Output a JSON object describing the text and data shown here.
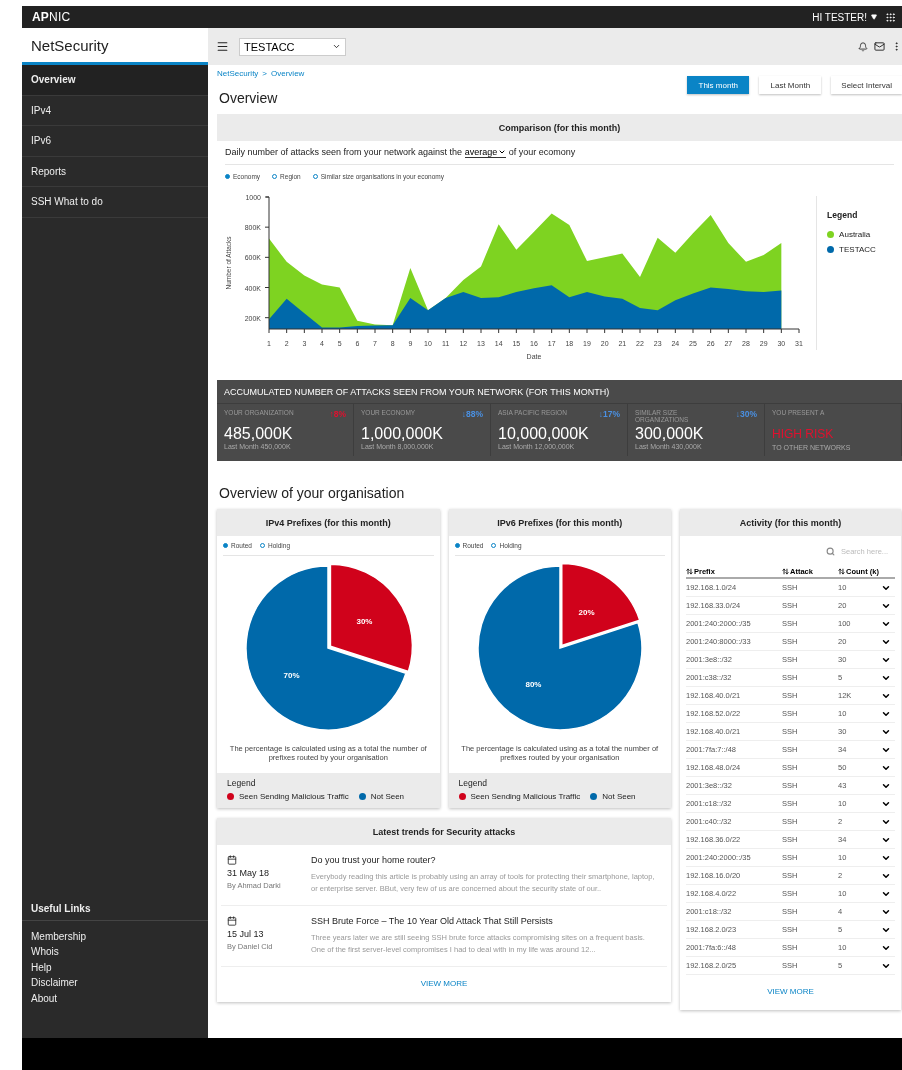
{
  "topbar": {
    "logo": "**AP**NIC",
    "user": "HI TESTER!"
  },
  "sidebar": {
    "title": "NetSecurity",
    "items": [
      {
        "label": "Overview",
        "selected": true
      },
      {
        "label": "IPv4",
        "selected": false
      },
      {
        "label": "IPv6",
        "selected": false
      },
      {
        "label": "Reports",
        "selected": false
      },
      {
        "label": "SSH What to do",
        "selected": false
      }
    ],
    "links_title": "Useful Links",
    "links": [
      "Membership",
      "Whois",
      "Help",
      "Disclaimer",
      "About"
    ]
  },
  "toolbar": {
    "account": "TESTACC"
  },
  "breadcrumb": {
    "items": [
      "NetSecurity",
      "Overview"
    ],
    "separator": ">"
  },
  "period_buttons": [
    {
      "label": "This month",
      "selected": true
    },
    {
      "label": "Last Month",
      "selected": false
    },
    {
      "label": "Select Interval",
      "selected": false
    }
  ],
  "page_title": "Overview",
  "comparison": {
    "title": "Comparison (for this month)",
    "sentence_before": "Daily number of attacks seen from your network against the",
    "dropdown": "average",
    "sentence_after": "of your ecomony",
    "filters": [
      {
        "label": "Economy",
        "selected": true
      },
      {
        "label": "Region",
        "selected": false
      },
      {
        "label": "Similar size organisations in your economy",
        "selected": false
      }
    ],
    "legend_title": "Legend",
    "chart_data": {
      "type": "area",
      "xlabel": "Date",
      "ylabel": "Number of Attacks",
      "x": [
        1,
        2,
        3,
        4,
        5,
        6,
        7,
        8,
        9,
        10,
        11,
        12,
        13,
        14,
        15,
        16,
        17,
        18,
        19,
        20,
        21,
        22,
        23,
        24,
        25,
        26,
        27,
        28,
        29,
        30
      ],
      "xticks": [
        1,
        2,
        3,
        4,
        5,
        6,
        7,
        8,
        9,
        10,
        11,
        12,
        13,
        14,
        15,
        16,
        17,
        18,
        19,
        20,
        21,
        22,
        23,
        24,
        25,
        26,
        27,
        28,
        29,
        30,
        31
      ],
      "xlim": [
        1,
        31
      ],
      "ylim": [
        125,
        1000
      ],
      "yticks": [
        {
          "value": 200,
          "label": "200K"
        },
        {
          "value": 400,
          "label": "400K"
        },
        {
          "value": 600,
          "label": "600K"
        },
        {
          "value": 800,
          "label": "800K"
        },
        {
          "value": 1000,
          "label": "1000"
        }
      ],
      "stacked": false,
      "series": [
        {
          "name": "Australia",
          "color": "#7ed321",
          "values": [
            725,
            570,
            480,
            420,
            400,
            180,
            155,
            150,
            530,
            250,
            330,
            450,
            540,
            820,
            650,
            770,
            890,
            815,
            575,
            600,
            625,
            470,
            730,
            630,
            760,
            880,
            695,
            570,
            615,
            695
          ]
        },
        {
          "name": "TESTACC",
          "color": "#0069aa",
          "values": [
            190,
            325,
            230,
            135,
            135,
            145,
            148,
            150,
            330,
            250,
            330,
            370,
            330,
            335,
            370,
            395,
            415,
            335,
            370,
            340,
            325,
            265,
            250,
            315,
            360,
            400,
            390,
            375,
            370,
            380
          ]
        }
      ]
    }
  },
  "accumulated": {
    "title": "ACCUMULATED NUMBER OF ATTACKS SEEN FROM YOUR NETWORK (FOR THIS MONTH)",
    "cells": [
      {
        "kind": "metric",
        "label": "YOUR ORGANIZATION",
        "change": "↑8%",
        "color": "#e0102e",
        "value": "485,000K",
        "previous": "Last Month 450,000K"
      },
      {
        "kind": "metric",
        "label": "YOUR ECONOMY",
        "change": "↓88%",
        "color": "#4a90e2",
        "value": "1,000,000K",
        "previous": "Last Month 8,000,000K"
      },
      {
        "kind": "metric",
        "label": "ASIA PACIFIC REGION",
        "change": "↓17%",
        "color": "#4a90e2",
        "value": "10,000,000K",
        "previous": "Last Month 12,000,000K"
      },
      {
        "kind": "metric",
        "label": "SIMILAR SIZE ORGANIZATIONS",
        "change": "↓30%",
        "color": "#4a90e2",
        "value": "300,000K",
        "previous": "Last Month 430,000K"
      },
      {
        "kind": "risk",
        "label": "YOU PRESENT A",
        "value": "HIGH RISK",
        "previous": "TO OTHER NETWORKS"
      }
    ]
  },
  "org_title": "Overview of your organisation",
  "prefix_cards": [
    {
      "title": "IPv4 Prefixes (for this month)",
      "filters": [
        {
          "label": "Routed",
          "selected": true
        },
        {
          "label": "Holding",
          "selected": false
        }
      ],
      "chart_data": {
        "type": "pie",
        "values": [
          30,
          70
        ],
        "value_labels": [
          "30%",
          "70%"
        ]
      },
      "note": "The percentage is calculated using as a total the number of prefixes routed by your organisation",
      "legend_title": "Legend",
      "legend": [
        {
          "label": "Seen Sending Malicious Traffic",
          "color": "#d0021b"
        },
        {
          "label": "Not Seen",
          "color": "#0069aa"
        }
      ]
    },
    {
      "title": "IPv6 Prefixes (for this month)",
      "filters": [
        {
          "label": "Routed",
          "selected": true
        },
        {
          "label": "Holding",
          "selected": false
        }
      ],
      "chart_data": {
        "type": "pie",
        "values": [
          20,
          80
        ],
        "value_labels": [
          "20%",
          "80%"
        ]
      },
      "note": "The percentage is calculated using as a total the number of prefixes routed by your organisation",
      "legend_title": "Legend",
      "legend": [
        {
          "label": "Seen Sending Malicious Traffic",
          "color": "#d0021b"
        },
        {
          "label": "Not Seen",
          "color": "#0069aa"
        }
      ]
    }
  ],
  "trends": {
    "title": "Latest trends for Security attacks",
    "articles": [
      {
        "date": "31 May 18",
        "author": "By Ahmad Darki",
        "title": "Do you trust your home router?",
        "excerpt": "Everybody reading this article is probably using an array of tools for protecting their smartphone, laptop, or enterprise server. BBut, very few of us are concerned about the security state of our.."
      },
      {
        "date": "15 Jul 13",
        "author": "By Daniel Cid",
        "title": "SSH Brute Force – The 10 Year Old Attack That Still Persists",
        "excerpt": "Three years later we are still seeing SSH brute force attacks compromising sites on a frequent basis. One of the first server-level compromises I had to deal with in my life was around 12..."
      }
    ],
    "more": "VIEW MORE"
  },
  "activity": {
    "title": "Activity (for this month)",
    "search_placeholder": "Search here...",
    "columns": [
      "Prefix",
      "Attack",
      "Count (k)"
    ],
    "rows": [
      {
        "prefix": "192.168.1.0/24",
        "attack": "SSH",
        "count": "10"
      },
      {
        "prefix": "192.168.33.0/24",
        "attack": "SSH",
        "count": "20"
      },
      {
        "prefix": "2001:240:2000::/35",
        "attack": "SSH",
        "count": "100"
      },
      {
        "prefix": "2001:240:8000::/33",
        "attack": "SSH",
        "count": "20"
      },
      {
        "prefix": "2001:3e8::/32",
        "attack": "SSH",
        "count": "30"
      },
      {
        "prefix": "2001:c38::/32",
        "attack": "SSH",
        "count": "5"
      },
      {
        "prefix": "192.168.40.0/21",
        "attack": "SSH",
        "count": "12K"
      },
      {
        "prefix": "192.168.52.0/22",
        "attack": "SSH",
        "count": "10"
      },
      {
        "prefix": "192.168.40.0/21",
        "attack": "SSH",
        "count": "30"
      },
      {
        "prefix": "2001:7fa:7::/48",
        "attack": "SSH",
        "count": "34"
      },
      {
        "prefix": "192.168.48.0/24",
        "attack": "SSH",
        "count": "50"
      },
      {
        "prefix": "2001:3e8::/32",
        "attack": "SSH",
        "count": "43"
      },
      {
        "prefix": "2001:c18::/32",
        "attack": "SSH",
        "count": "10"
      },
      {
        "prefix": "2001:c40::/32",
        "attack": "SSH",
        "count": "2"
      },
      {
        "prefix": "192.168.36.0/22",
        "attack": "SSH",
        "count": "34"
      },
      {
        "prefix": "2001:240:2000::/35",
        "attack": "SSH",
        "count": "10"
      },
      {
        "prefix": "192.168.16.0/20",
        "attack": "SSH",
        "count": "2"
      },
      {
        "prefix": "192.168.4.0/22",
        "attack": "SSH",
        "count": "10"
      },
      {
        "prefix": "2001:c18::/32",
        "attack": "SSH",
        "count": "4"
      },
      {
        "prefix": "192.168.2.0/23",
        "attack": "SSH",
        "count": "5"
      },
      {
        "prefix": "2001:7fa:6::/48",
        "attack": "SSH",
        "count": "10"
      },
      {
        "prefix": "192.168.2.0/25",
        "attack": "SSH",
        "count": "5"
      }
    ],
    "more": "VIEW MORE"
  }
}
